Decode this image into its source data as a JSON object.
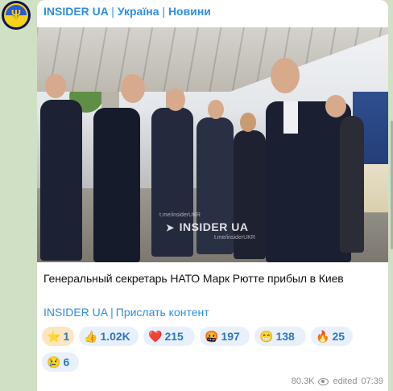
{
  "channel": {
    "name": "INSIDER UA",
    "tags": [
      "Україна",
      "Новини"
    ],
    "separator": "|"
  },
  "photo": {
    "watermark": "INSIDER UA",
    "watermark_small_1": "t.me/insiderUKR",
    "watermark_small_2": "t.me/insiderUKR"
  },
  "post": {
    "caption": "Генеральный секретарь НАТО Марк Рютте прибыл в Киев",
    "link_channel": "INSIDER UA",
    "link_separator": "|",
    "link_submit": "Прислать контент"
  },
  "reactions": [
    {
      "emoji": "⭐",
      "count": "1"
    },
    {
      "emoji": "👍",
      "count": "1.02K"
    },
    {
      "emoji": "❤️",
      "count": "215"
    },
    {
      "emoji": "🤬",
      "count": "197"
    },
    {
      "emoji": "😁",
      "count": "138"
    },
    {
      "emoji": "🔥",
      "count": "25"
    },
    {
      "emoji": "😢",
      "count": "6"
    }
  ],
  "meta": {
    "views": "80.3K",
    "edited": "edited",
    "time": "07:39"
  },
  "colors": {
    "accent": "#2f8ee0",
    "background": "#cfe0c4",
    "reaction_bg": "#e8f1fb",
    "star_bg": "#fbe6c0"
  }
}
